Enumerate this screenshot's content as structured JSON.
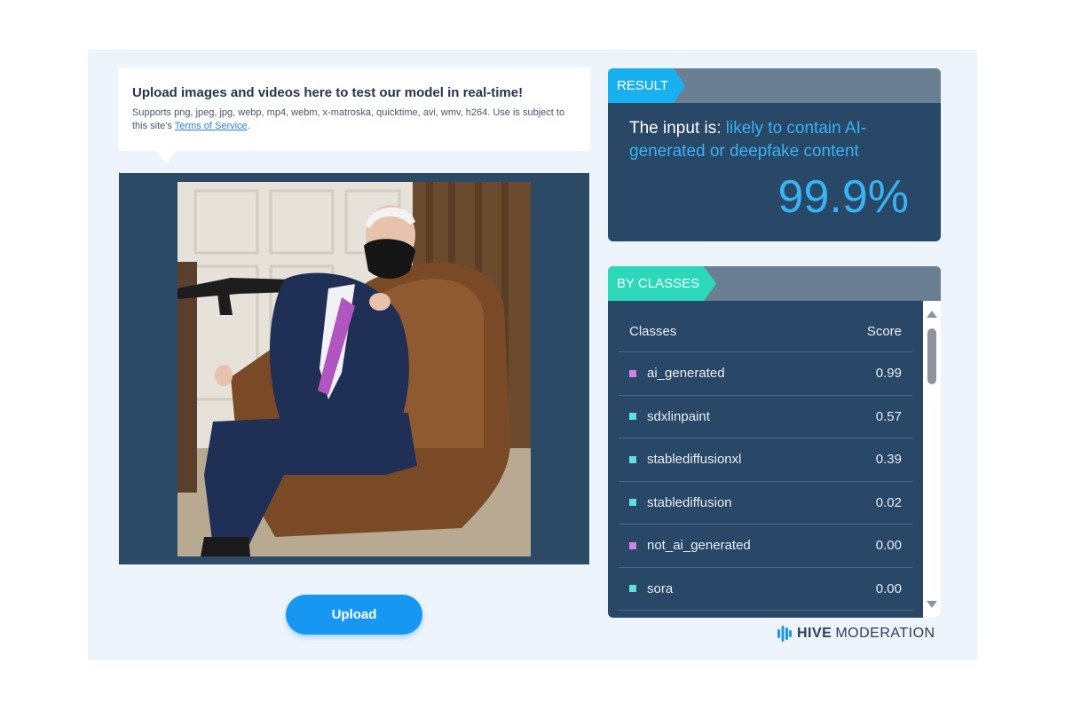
{
  "info": {
    "title": "Upload images and videos here to test our model in real-time!",
    "description": "Supports png, jpeg, jpg, webp, mp4, webm, x-matroska, quicktime, avi, wmv, h264. Use is subject to this site's",
    "terms_link": "Terms of Service",
    "terms_suffix": "."
  },
  "upload": {
    "label": "Upload"
  },
  "result": {
    "tag": "RESULT",
    "prefix": "The input is: ",
    "verdict": "likely to contain AI-generated or deepfake content",
    "percentage": "99.9%"
  },
  "classes": {
    "tag": "BY CLASSES",
    "header_class": "Classes",
    "header_score": "Score",
    "rows": [
      {
        "name": "ai_generated",
        "score": "0.99",
        "color": "#d77fe0"
      },
      {
        "name": "sdxlinpaint",
        "score": "0.57",
        "color": "#5ee0e0"
      },
      {
        "name": "stablediffusionxl",
        "score": "0.39",
        "color": "#5ee0e0"
      },
      {
        "name": "stablediffusion",
        "score": "0.02",
        "color": "#5ee0e0"
      },
      {
        "name": "not_ai_generated",
        "score": "0.00",
        "color": "#d77fe0"
      },
      {
        "name": "sora",
        "score": "0.00",
        "color": "#5ee0e0"
      }
    ]
  },
  "logo": {
    "bold": "HIVE",
    "rest": "MODERATION"
  },
  "colors": {
    "accent_blue": "#37b4f4",
    "result_tag": "#19b0f0",
    "classes_tag": "#2cd8b9",
    "card_bg": "#294766",
    "upload_button": "#1797f2"
  }
}
